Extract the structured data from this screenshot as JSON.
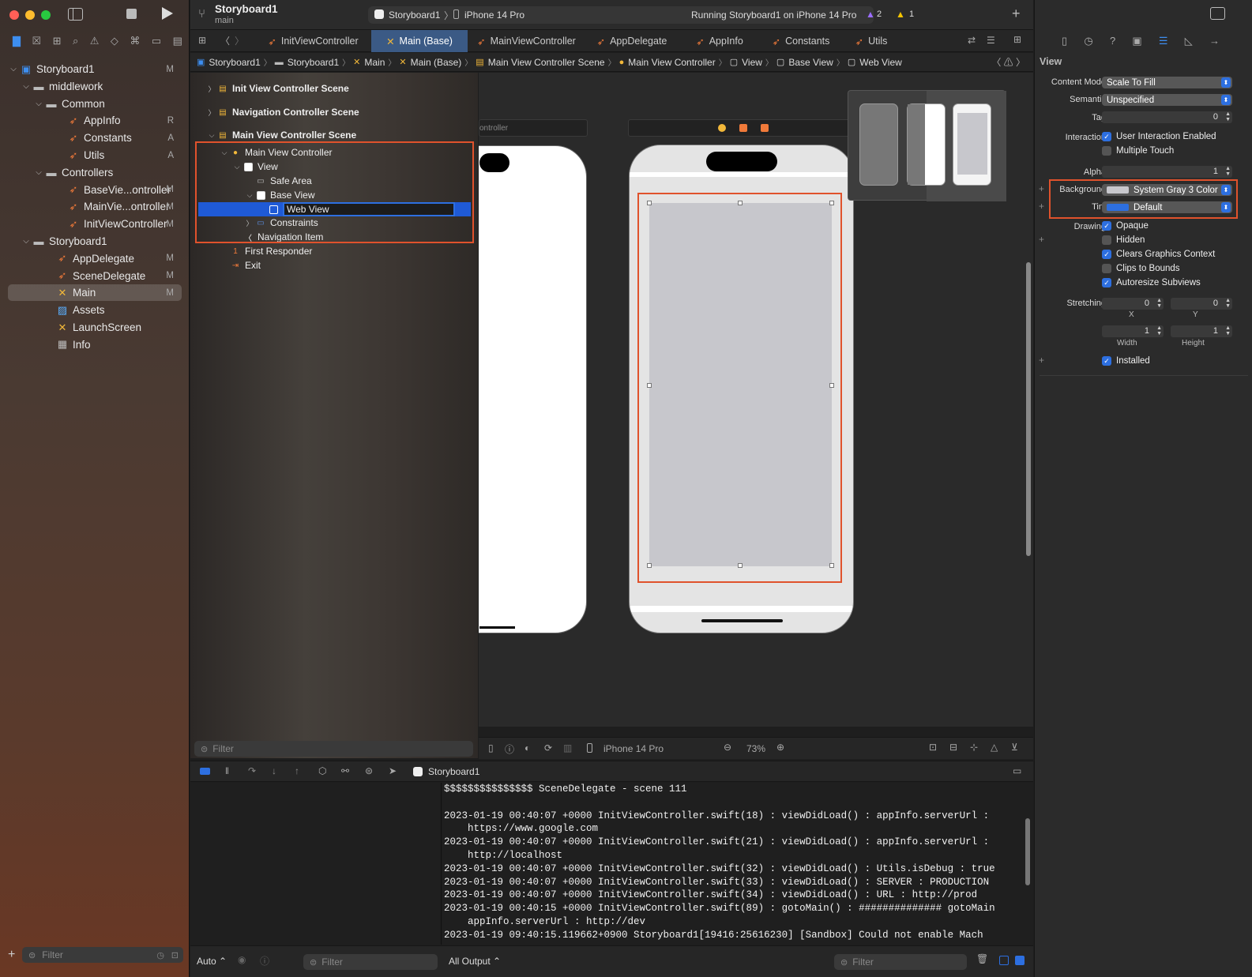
{
  "navigator": {
    "filter_placeholder": "Filter",
    "items": [
      {
        "label": "Storyboard1",
        "badge": "M",
        "icon": "project-icon"
      },
      {
        "label": "middlework",
        "badge": "",
        "icon": "folder-icon"
      },
      {
        "label": "Common",
        "badge": "",
        "icon": "folder-icon"
      },
      {
        "label": "AppInfo",
        "badge": "R",
        "icon": "swift-icon"
      },
      {
        "label": "Constants",
        "badge": "A",
        "icon": "swift-icon"
      },
      {
        "label": "Utils",
        "badge": "A",
        "icon": "swift-icon"
      },
      {
        "label": "Controllers",
        "badge": "",
        "icon": "folder-icon"
      },
      {
        "label": "BaseVie...ontroller",
        "badge": "M",
        "icon": "swift-icon"
      },
      {
        "label": "MainVie...ontroller",
        "badge": "M",
        "icon": "swift-icon"
      },
      {
        "label": "InitViewController",
        "badge": "M",
        "icon": "swift-icon"
      },
      {
        "label": "Storyboard1",
        "badge": "",
        "icon": "folder-icon"
      },
      {
        "label": "AppDelegate",
        "badge": "M",
        "icon": "swift-icon"
      },
      {
        "label": "SceneDelegate",
        "badge": "M",
        "icon": "swift-icon"
      },
      {
        "label": "Main",
        "badge": "M",
        "icon": "storyboard-icon"
      },
      {
        "label": "Assets",
        "badge": "",
        "icon": "assets-icon"
      },
      {
        "label": "LaunchScreen",
        "badge": "",
        "icon": "storyboard-icon"
      },
      {
        "label": "Info",
        "badge": "",
        "icon": "plist-icon"
      }
    ]
  },
  "toolbar": {
    "project": "Storyboard1",
    "branch": "main",
    "scheme": "Storyboard1",
    "destination": "iPhone 14 Pro",
    "status": "Running Storyboard1 on iPhone 14 Pro",
    "warnings": "2",
    "issues": "1"
  },
  "tabs": [
    "InitViewController",
    "Main (Base)",
    "MainViewController",
    "AppDelegate",
    "AppInfo",
    "Constants",
    "Utils"
  ],
  "breadcrumbs": [
    "Storyboard1",
    "Storyboard1",
    "Main",
    "Main (Base)",
    "Main View Controller Scene",
    "Main View Controller",
    "View",
    "Base View",
    "Web View"
  ],
  "outline": {
    "filter_placeholder": "Filter",
    "rows": [
      "Init View Controller Scene",
      "Navigation Controller Scene",
      "Main View Controller Scene",
      "Main View Controller",
      "View",
      "Safe Area",
      "Base View",
      "Web View",
      "Constraints",
      "Navigation Item",
      "First Responder",
      "Exit"
    ]
  },
  "canvas": {
    "left_scene_title": "ontroller",
    "device": "iPhone 14 Pro",
    "zoom": "73%"
  },
  "inspector": {
    "title": "View",
    "content_mode_label": "Content Mode",
    "content_mode": "Scale To Fill",
    "semantic_label": "Semantic",
    "semantic": "Unspecified",
    "tag_label": "Tag",
    "tag": "0",
    "interaction_label": "Interaction",
    "user_interaction": "User Interaction Enabled",
    "multiple_touch": "Multiple Touch",
    "alpha_label": "Alpha",
    "alpha": "1",
    "background_label": "Background",
    "background": "System Gray 3 Color",
    "tint_label": "Tint",
    "tint": "Default",
    "drawing_label": "Drawing",
    "opaque": "Opaque",
    "hidden": "Hidden",
    "clears": "Clears Graphics Context",
    "clips": "Clips to Bounds",
    "autoresize": "Autoresize Subviews",
    "stretching_label": "Stretching",
    "stretch_x": "0",
    "stretch_y": "0",
    "x_label": "X",
    "y_label": "Y",
    "stretch_w": "1",
    "stretch_h": "1",
    "width_label": "Width",
    "height_label": "Height",
    "installed": "Installed"
  },
  "debug": {
    "process": "Storyboard1",
    "auto_label": "Auto ⌃",
    "output_label": "All Output ⌃",
    "filter_placeholder": "Filter",
    "console_filter_placeholder": "Filter",
    "lines": [
      "$$$$$$$$$$$$$$$ SceneDelegate - scene 111",
      "",
      "2023-01-19 00:40:07 +0000 InitViewController.swift(18) : viewDidLoad() : appInfo.serverUrl :",
      "    https://www.google.com",
      "2023-01-19 00:40:07 +0000 InitViewController.swift(21) : viewDidLoad() : appInfo.serverUrl :",
      "    http://localhost",
      "2023-01-19 00:40:07 +0000 InitViewController.swift(32) : viewDidLoad() : Utils.isDebug : true",
      "2023-01-19 00:40:07 +0000 InitViewController.swift(33) : viewDidLoad() : SERVER : PRODUCTION",
      "2023-01-19 00:40:07 +0000 InitViewController.swift(34) : viewDidLoad() : URL : http://prod",
      "2023-01-19 00:40:15 +0000 InitViewController.swift(89) : gotoMain() : ############## gotoMain",
      "    appInfo.serverUrl : http://dev",
      "2023-01-19 09:40:15.119662+0900 Storyboard1[19416:25616230] [Sandbox] Could not enable Mach"
    ]
  },
  "colors": {
    "accent": "#2d6fe0",
    "highlight": "#e0522c",
    "swift": "#f07a3a"
  }
}
